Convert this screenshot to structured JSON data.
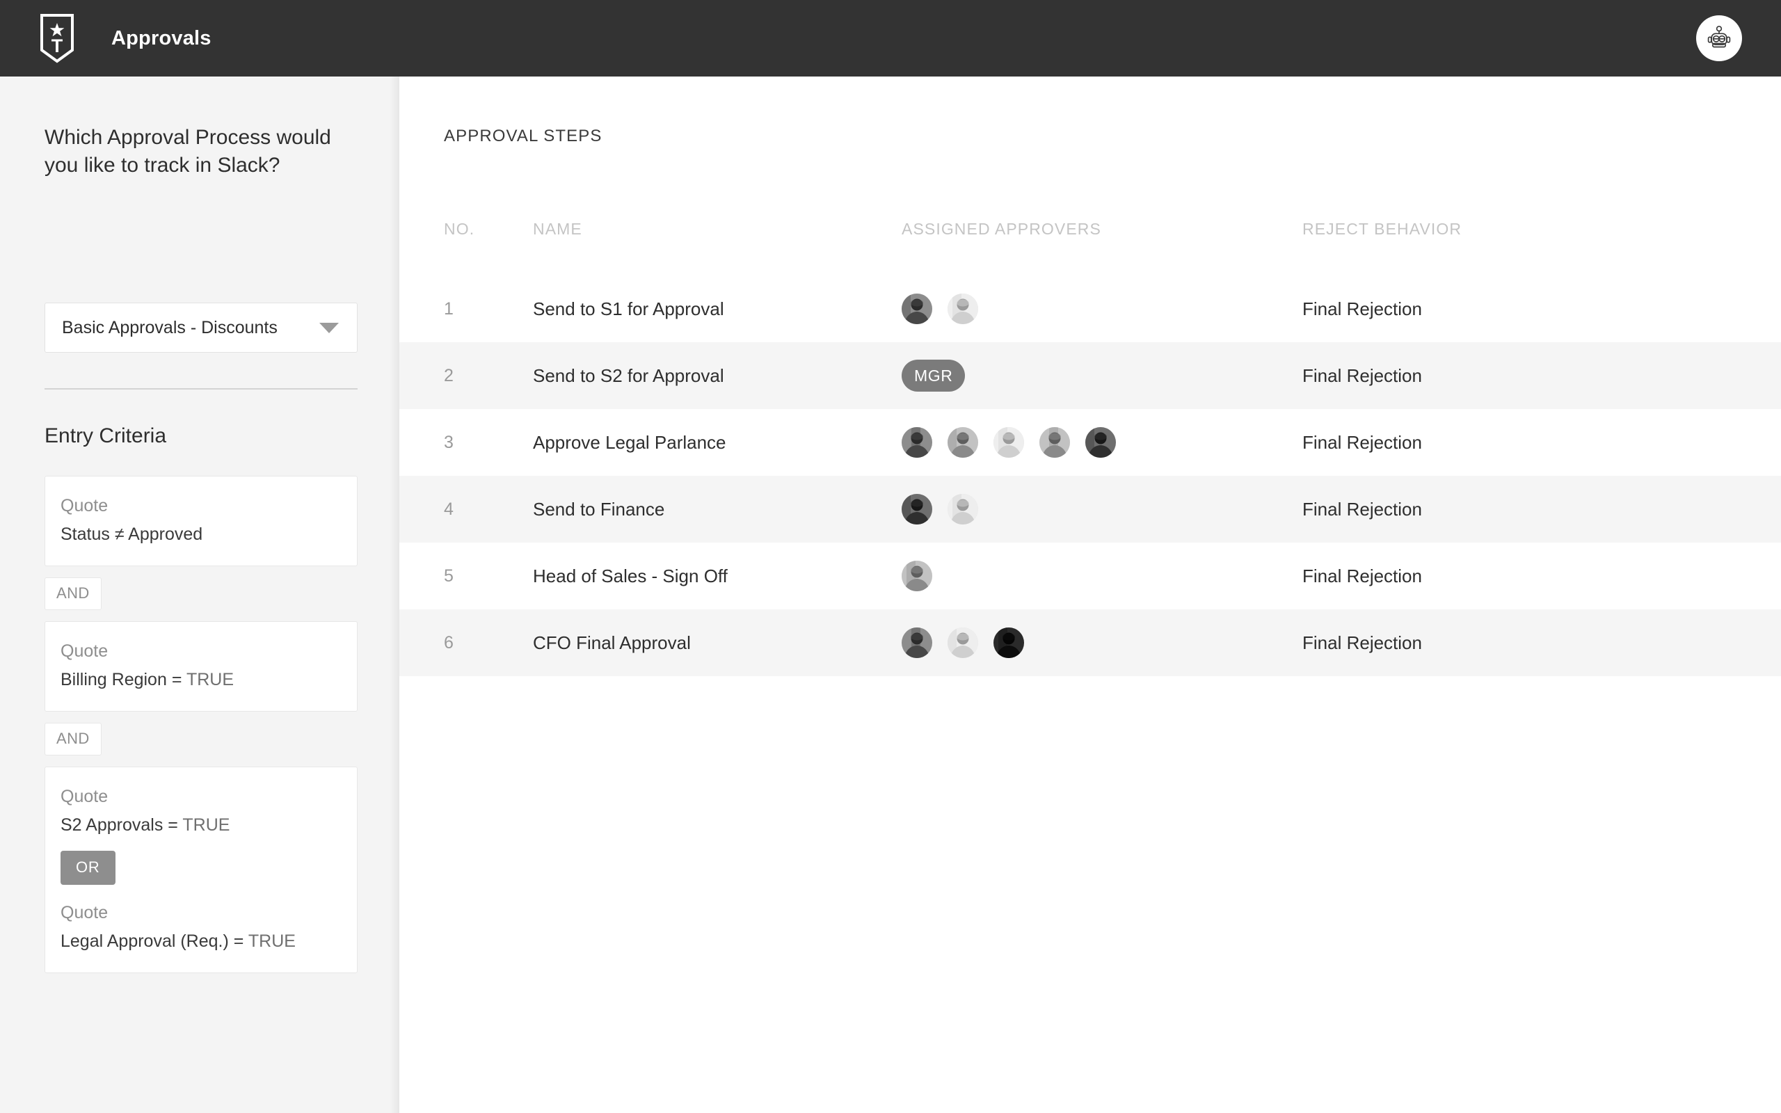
{
  "header": {
    "app_title": "Approvals",
    "logo_icon": "shield-star-t-logo",
    "bot_icon": "robot-avatar-icon"
  },
  "sidebar": {
    "question": "Which Approval Process would you like to track in Slack?",
    "process_select": {
      "value": "Basic Approvals - Discounts",
      "caret_icon": "chevron-down-icon"
    },
    "entry_criteria_title": "Entry Criteria",
    "criteria": [
      {
        "object": "Quote",
        "field": "Status",
        "operator": "≠",
        "value": "Approved",
        "value_muted": false
      },
      {
        "connector": "AND"
      },
      {
        "object": "Quote",
        "field": "Billing Region",
        "operator": "=",
        "value": "TRUE",
        "value_muted": true
      },
      {
        "connector": "AND"
      },
      {
        "object": "Quote",
        "field": "S2 Approvals",
        "operator": "=",
        "value": "TRUE",
        "value_muted": true,
        "inner_connector": "OR",
        "second": {
          "object": "Quote",
          "field": "Legal Approval (Req.)",
          "operator": "=",
          "value": "TRUE",
          "value_muted": true
        }
      }
    ]
  },
  "main": {
    "panel_title": "APPROVAL STEPS",
    "columns": [
      "NO.",
      "NAME",
      "ASSIGNED APPROVERS",
      "REJECT BEHAVIOR"
    ],
    "rows": [
      {
        "no": "1",
        "name": "Send to S1 for Approval",
        "approvers": [
          {
            "type": "photo",
            "tone": "dark",
            "name": "approver-avatar"
          },
          {
            "type": "photo",
            "tone": "light",
            "name": "approver-avatar"
          }
        ],
        "reject_behavior": "Final Rejection"
      },
      {
        "no": "2",
        "name": "Send to S2 for Approval",
        "approvers": [
          {
            "type": "badge",
            "label": "MGR",
            "name": "approver-role-badge"
          }
        ],
        "reject_behavior": "Final Rejection"
      },
      {
        "no": "3",
        "name": "Approve Legal Parlance",
        "approvers": [
          {
            "type": "photo",
            "tone": "dark",
            "name": "approver-avatar"
          },
          {
            "type": "photo",
            "tone": "mid",
            "name": "approver-avatar"
          },
          {
            "type": "photo",
            "tone": "light",
            "name": "approver-avatar"
          },
          {
            "type": "photo",
            "tone": "mid",
            "name": "approver-avatar"
          },
          {
            "type": "photo",
            "tone": "darker",
            "name": "approver-avatar"
          }
        ],
        "reject_behavior": "Final Rejection"
      },
      {
        "no": "4",
        "name": "Send to Finance",
        "approvers": [
          {
            "type": "photo",
            "tone": "darker",
            "name": "approver-avatar"
          },
          {
            "type": "photo",
            "tone": "light",
            "name": "approver-avatar"
          }
        ],
        "reject_behavior": "Final Rejection"
      },
      {
        "no": "5",
        "name": "Head of Sales - Sign Off",
        "approvers": [
          {
            "type": "photo",
            "tone": "mid",
            "name": "approver-avatar"
          }
        ],
        "reject_behavior": "Final Rejection"
      },
      {
        "no": "6",
        "name": "CFO Final Approval",
        "approvers": [
          {
            "type": "photo",
            "tone": "dark",
            "name": "approver-avatar"
          },
          {
            "type": "photo",
            "tone": "light",
            "name": "approver-avatar"
          },
          {
            "type": "photo",
            "tone": "black",
            "name": "approver-avatar"
          }
        ],
        "reject_behavior": "Final Rejection"
      }
    ]
  },
  "colors": {
    "topbar_bg": "#333333",
    "sidebar_bg": "#f4f4f4",
    "row_alt_bg": "#f5f5f5",
    "badge_bg": "#7b7b7b",
    "header_text": "#c4c4c4",
    "body_text": "#2e2e2e"
  }
}
